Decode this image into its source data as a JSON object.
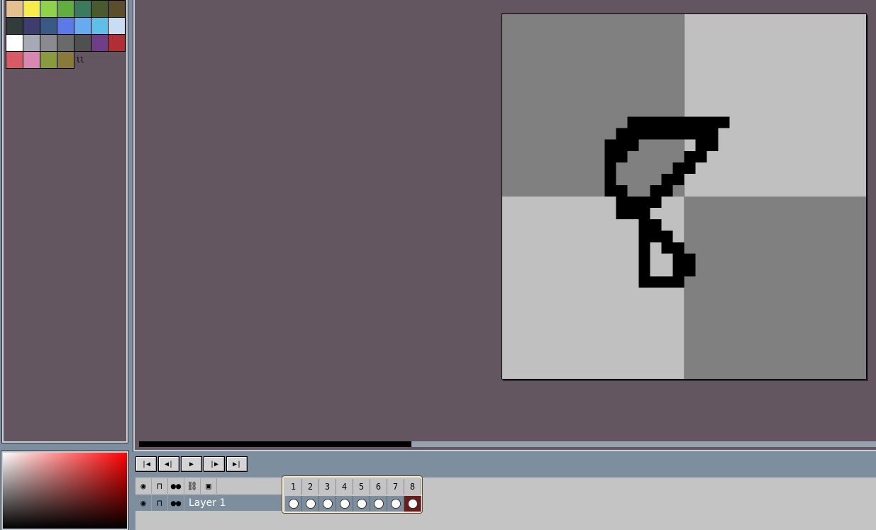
{
  "palette": {
    "colors": [
      "#e3c18f",
      "#f4ed4a",
      "#8fd34a",
      "#5fae3e",
      "#3a7a5e",
      "#4a5a2a",
      "#5a4f2a",
      "#323c3a",
      "#3e3e6e",
      "#3a5a86",
      "#5a7ae8",
      "#66aaf2",
      "#5ec0e8",
      "#c8dcf4",
      "#ffffff",
      "#a6aab4",
      "#8a8a90",
      "#6a6a6a",
      "#505050",
      "#6e3e86",
      "#b22e36",
      "#d85a66",
      "#d888b0",
      "#8a9a3e",
      "#8a7a3a"
    ],
    "resize_handle": "ll"
  },
  "color_picker": {
    "hue_color": "#ff0000"
  },
  "animation_controls": [
    {
      "name": "first-frame-button",
      "icon": "first-frame-icon",
      "glyph": "⏮"
    },
    {
      "name": "previous-frame-button",
      "icon": "previous-frame-icon",
      "glyph": "◀"
    },
    {
      "name": "play-button",
      "icon": "play-icon",
      "glyph": "▶"
    },
    {
      "name": "next-frame-button",
      "icon": "next-frame-icon",
      "glyph": "▶"
    },
    {
      "name": "last-frame-button",
      "icon": "last-frame-icon",
      "glyph": "⏭"
    }
  ],
  "timeline": {
    "header_icons": [
      "eye-icon",
      "padlock-icon",
      "continuous-icon",
      "link-icon",
      "onion-skin-icon"
    ],
    "layer": {
      "name": "Layer 1",
      "icons": [
        "eye-icon",
        "padlock-icon",
        "continuous-icon"
      ]
    },
    "frames": [
      "1",
      "2",
      "3",
      "4",
      "5",
      "6",
      "7",
      "8"
    ],
    "active_frame": 8
  },
  "colors": {
    "editor_bg": "#645660",
    "workspace_bg": "#7d8f9e",
    "checker_dark": "#808080",
    "checker_light": "#c0c0c0",
    "ink": "#000000",
    "active_cel": "#6e1a1a"
  }
}
